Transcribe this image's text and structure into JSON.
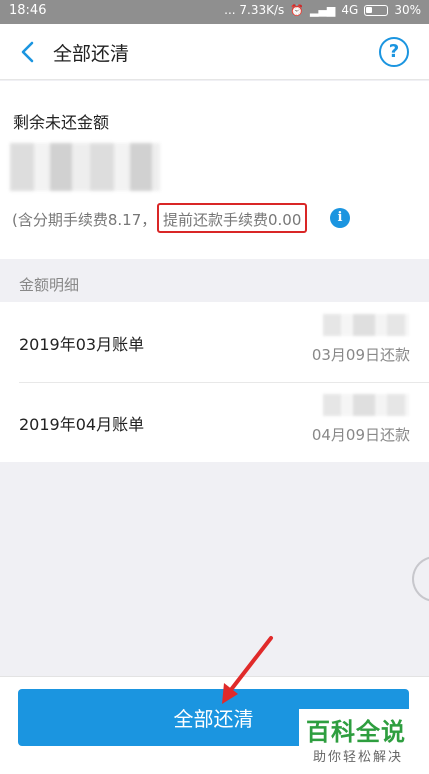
{
  "status_bar": {
    "time": "18:46",
    "speed": "... 7.33K/s",
    "network": "4G",
    "battery": "30%"
  },
  "nav": {
    "title": "全部还清",
    "back_icon": "chevron-left-icon",
    "help_icon": "question-circle-icon",
    "help_glyph": "?"
  },
  "summary": {
    "remaining_label": "剩余未还金额",
    "installment_fee": "(含分期手续费8.17，",
    "prepayment_fee": "提前还款手续费0.00",
    "info_glyph": "i"
  },
  "details": {
    "header": "金额明细",
    "bills": [
      {
        "name": "2019年03月账单",
        "due": "03月09日还款"
      },
      {
        "name": "2019年04月账单",
        "due": "04月09日还款"
      }
    ]
  },
  "actions": {
    "payoff_label": "全部还清"
  },
  "watermark": {
    "title": "百科全说",
    "subtitle": "助你轻松解决"
  },
  "colors": {
    "accent": "#1b95e0",
    "highlight_box": "#d92626",
    "arrow": "#e02a2a",
    "watermark": "#2e9e3f"
  }
}
